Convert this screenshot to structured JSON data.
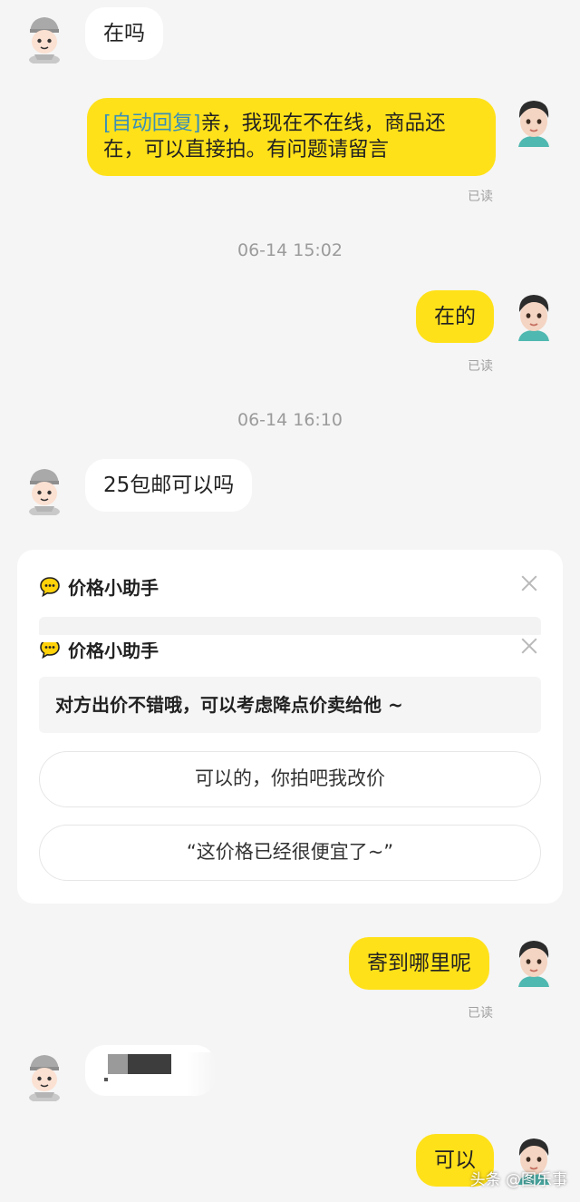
{
  "messages": {
    "m1": {
      "text": "在吗"
    },
    "m2": {
      "tag": "[自动回复]",
      "text": "亲，我现在不在线，商品还在，可以直接拍。有问题请留言",
      "status": "已读"
    },
    "t1": "06-14 15:02",
    "m3": {
      "text": "在的",
      "status": "已读"
    },
    "t2": "06-14 16:10",
    "m4": {
      "text": "25包邮可以吗"
    },
    "m5": {
      "text": "寄到哪里呢",
      "status": "已读"
    },
    "m7": {
      "text": "可以"
    }
  },
  "price_helper": {
    "title": "价格小助手",
    "tip": "对方出价不错哦，可以考虑降点价卖给他 ~",
    "options": [
      "可以的，你拍吧我改价",
      "“这价格已经很便宜了~”"
    ],
    "icon": "chat-bubble-icon"
  },
  "watermark": "头条 @图乐事",
  "colors": {
    "outgoing_bubble": "#ffe11a",
    "incoming_bubble": "#ffffff",
    "auto_tag": "#3a8fb7",
    "background": "#f5f5f5"
  }
}
